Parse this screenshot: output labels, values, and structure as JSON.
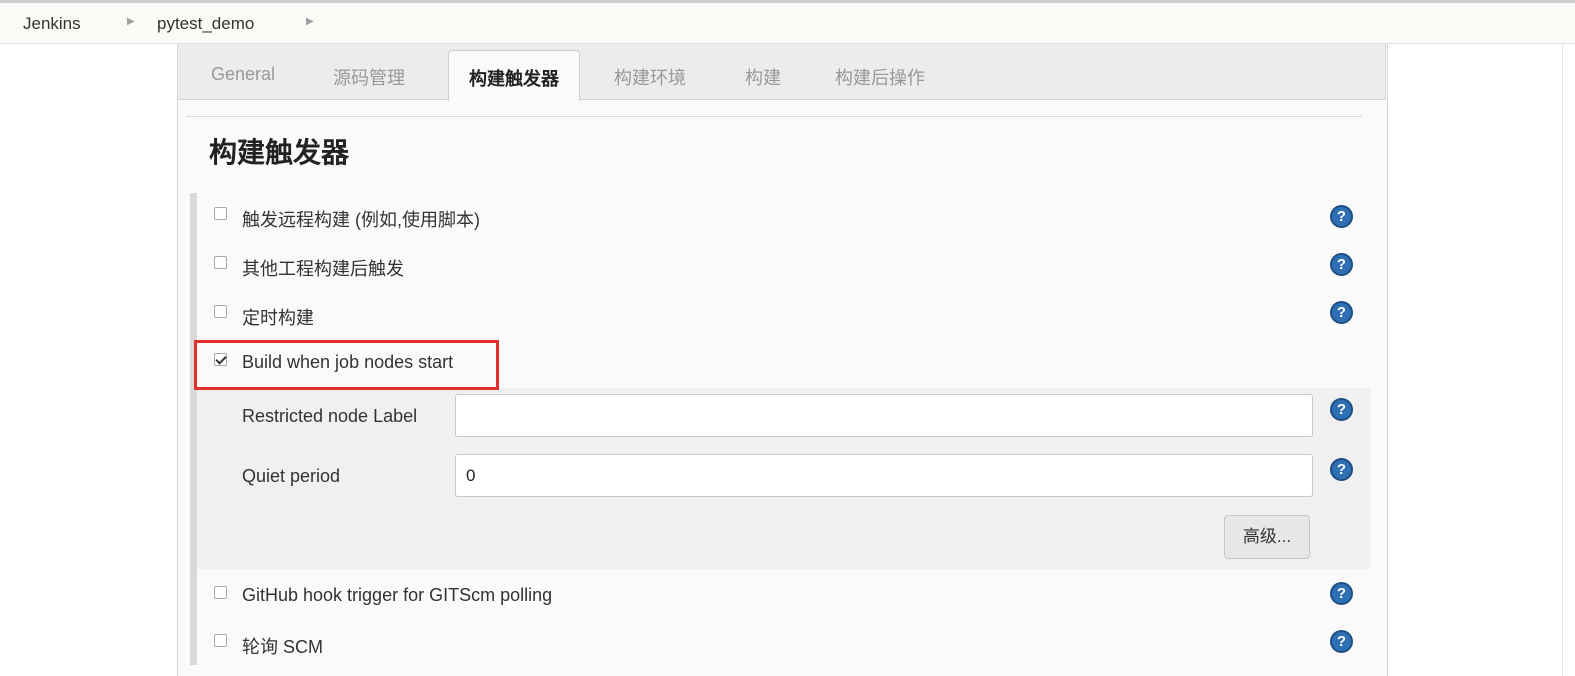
{
  "breadcrumb": {
    "items": [
      {
        "label": "Jenkins"
      },
      {
        "label": "pytest_demo"
      }
    ],
    "separator": "▶"
  },
  "tabs": [
    {
      "label": "General",
      "active": false
    },
    {
      "label": "源码管理",
      "active": false
    },
    {
      "label": "构建触发器",
      "active": true
    },
    {
      "label": "构建环境",
      "active": false
    },
    {
      "label": "构建",
      "active": false
    },
    {
      "label": "构建后操作",
      "active": false
    }
  ],
  "section": {
    "title": "构建触发器"
  },
  "triggers": [
    {
      "label": "触发远程构建 (例如,使用脚本)",
      "checked": false
    },
    {
      "label": "其他工程构建后触发",
      "checked": false
    },
    {
      "label": "定时构建",
      "checked": false
    },
    {
      "label": "Build when job nodes start",
      "checked": true
    },
    {
      "label": "GitHub hook trigger for GITScm polling",
      "checked": false
    },
    {
      "label": "轮询 SCM",
      "checked": false
    }
  ],
  "node_start_options": {
    "restricted_label": {
      "label": "Restricted node Label",
      "value": ""
    },
    "quiet_period": {
      "label": "Quiet period",
      "value": "0"
    },
    "advanced_button": "高级..."
  },
  "help_icon_glyph": "?",
  "colors": {
    "highlight": "#e0302c",
    "help_icon": "#2f6fb3",
    "tab_bar": "#ececec"
  }
}
